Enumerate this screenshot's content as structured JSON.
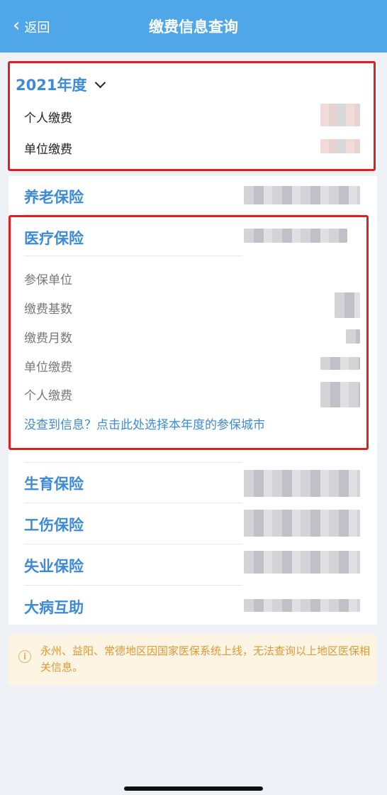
{
  "header": {
    "back_label": "返回",
    "title": "缴费信息查询"
  },
  "year_section": {
    "year": "2021年度",
    "personal_label": "个人缴费",
    "unit_label": "单位缴费"
  },
  "insurances": {
    "pension": "养老保险",
    "medical": "医疗保险",
    "maternity": "生育保险",
    "injury": "工伤保险",
    "unemployment": "失业保险",
    "critical_illness": "大病互助"
  },
  "medical_details": {
    "employer": "参保单位",
    "base": "缴费基数",
    "months": "缴费月数",
    "unit_payment": "单位缴费",
    "personal_payment": "个人缴费",
    "link": "没查到信息？点击此处选择本年度的参保城市"
  },
  "notice": {
    "text": "永州、益阳、常德地区因国家医保系统上线，无法查询以上地区医保相关信息。"
  },
  "colors": {
    "header_bg": "#4fa7ea",
    "accent_blue": "#3d8ad6",
    "highlight_red": "#e02020",
    "notice_bg": "#fdf4e3",
    "notice_text": "#d99a39"
  }
}
